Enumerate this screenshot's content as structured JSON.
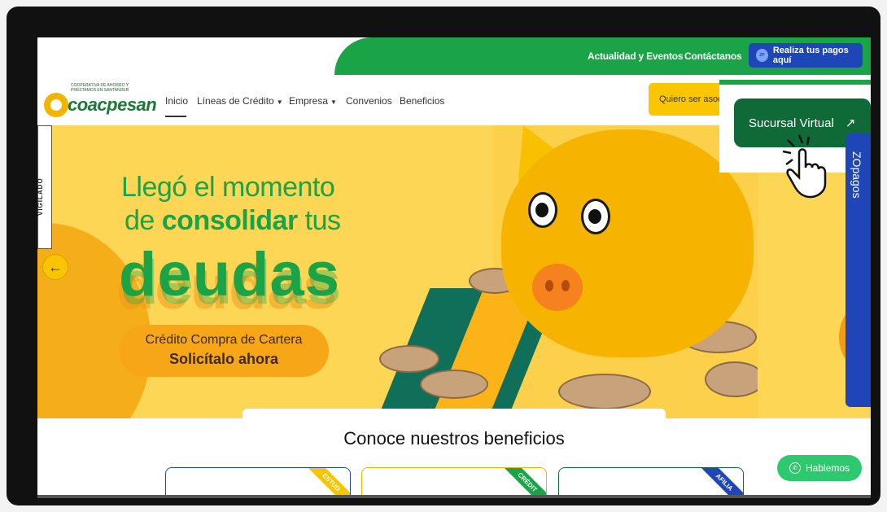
{
  "topbar": {
    "links": [
      "Actualidad y Eventos",
      "Contáctanos"
    ],
    "pay_button": "Realiza tus pagos aquí"
  },
  "logo": {
    "small_text": "COOPERATIVA DE AHORRO Y PRÉSTAMOS EN SANTANDER",
    "name": "coacpesan"
  },
  "nav": {
    "items": [
      "Inicio",
      "Líneas de Crédito",
      "Empresa",
      "Convenios",
      "Beneficios"
    ],
    "associate_button": "Quiero ser asoc"
  },
  "hero": {
    "line1": "Llegó el momento",
    "line2_prefix": "de ",
    "line2_bold": "consolidar",
    "line2_suffix": " tus",
    "big_word": "deudas",
    "cta_line1": "Crédito Compra de Cartera",
    "cta_line2": "Solicítalo ahora",
    "vigilado": "VIGILADO"
  },
  "sucursal": {
    "label": "Sucursal Virtual"
  },
  "zpagos": {
    "label": "ZOpagos"
  },
  "benefits": {
    "title": "Conoce nuestros beneficios",
    "cards": [
      {
        "ribbon": "ESTUD",
        "color": "#1e46b6",
        "ribbon_color": "#f9c400"
      },
      {
        "ribbon": "CRÉDIT",
        "color": "#f5b000",
        "ribbon_color": "#1aa447"
      },
      {
        "ribbon": "AFILIA",
        "color": "#0f6a38",
        "ribbon_color": "#1e46b6"
      }
    ]
  },
  "chat": {
    "label": "Hablemos"
  },
  "colors": {
    "green": "#1aa447",
    "blue": "#1e46b6",
    "yellow": "#fcd04a",
    "dark_green": "#0f6a38"
  }
}
